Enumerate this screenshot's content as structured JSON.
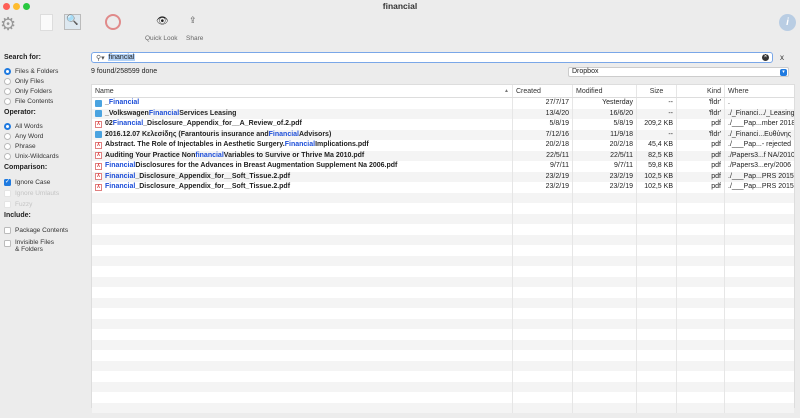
{
  "window": {
    "title": "financial"
  },
  "toolbar": {
    "quick_look": "Quick Look",
    "share": "Share"
  },
  "sidebar": {
    "search_for": {
      "label": "Search for:",
      "options": [
        "Files & Folders",
        "Only Files",
        "Only Folders",
        "File Contents"
      ],
      "selected": 0
    },
    "operator": {
      "label": "Operator:",
      "options": [
        "All Words",
        "Any Word",
        "Phrase",
        "Unix-Wildcards"
      ],
      "selected": 0
    },
    "comparison": {
      "label": "Comparison:",
      "ignore_case": "Ignore Case",
      "ignore_umlauts": "Ignore Umlauts",
      "fuzzy": "Fuzzy"
    },
    "include": {
      "label": "Include:",
      "package_contents": "Package Contents",
      "invisible_1": "Invisible Files",
      "invisible_2": "& Folders"
    }
  },
  "search": {
    "value": "financial",
    "status": "9 found/258599 done",
    "location": "Dropbox",
    "close": "x"
  },
  "table": {
    "headers": {
      "name": "Name",
      "created": "Created",
      "modified": "Modified",
      "size": "Size",
      "kind": "Kind",
      "where": "Where"
    },
    "rows": [
      {
        "type": "folder",
        "pre": "_",
        "hl": "Financial",
        "post": "",
        "created": "27/7/17",
        "modified": "Yesterday",
        "size": "--",
        "kind": "'fldr'",
        "where": "."
      },
      {
        "type": "folder",
        "pre": "_Volkswagen ",
        "hl": "Financial",
        "post": " Services Leasing",
        "created": "13/4/20",
        "modified": "16/6/20",
        "size": "--",
        "kind": "'fldr'",
        "where": "./_Financi.../_Leasing"
      },
      {
        "type": "pdf",
        "pre": "02 ",
        "hl": "Financial",
        "post": "_Disclosure_Appendix_for__A_Review_of.2.pdf",
        "created": "5/8/19",
        "modified": "5/8/19",
        "size": "209,2 KB",
        "kind": "pdf",
        "where": "./___Pap...mber 2018"
      },
      {
        "type": "folder",
        "pre": "2016.12.07 Κελεσίδης (Farantouris insurance and ",
        "hl": "Financial",
        "post": " Advisors)",
        "created": "7/12/16",
        "modified": "11/9/18",
        "size": "--",
        "kind": "'fldr'",
        "where": "./_Financi...Ευθύνης"
      },
      {
        "type": "pdf",
        "pre": "Abstract. The Role of Injectables in Aesthetic Surgery. ",
        "hl": "Financial",
        "post": " Implications.pdf",
        "created": "20/2/18",
        "modified": "20/2/18",
        "size": "45,4 KB",
        "kind": "pdf",
        "where": "./___Pap...- rejected"
      },
      {
        "type": "pdf",
        "pre": "Auditing Your Practice Non",
        "hl": "financial",
        "post": " Variables to Survive or Thrive Ma 2010.pdf",
        "created": "22/5/11",
        "modified": "22/5/11",
        "size": "82,5 KB",
        "kind": "pdf",
        "where": "./Papers3...f NA/2010"
      },
      {
        "type": "pdf",
        "pre": "",
        "hl": "Financial",
        "post": " Disclosures for the Advances in Breast Augmentation Supplement Na 2006.pdf",
        "created": "9/7/11",
        "modified": "9/7/11",
        "size": "59,8 KB",
        "kind": "pdf",
        "where": "./Papers3...ery/2006"
      },
      {
        "type": "pdf",
        "pre": "",
        "hl": "Financial",
        "post": "_Disclosure_Appendix_for__Soft_Tissue.2.pdf",
        "created": "23/2/19",
        "modified": "23/2/19",
        "size": "102,5 KB",
        "kind": "pdf",
        "where": "./___Pap...PRS 2015"
      },
      {
        "type": "pdf",
        "pre": "",
        "hl": "Financial",
        "post": "_Disclosure_Appendix_for__Soft_Tissue.2.pdf",
        "created": "23/2/19",
        "modified": "23/2/19",
        "size": "102,5 KB",
        "kind": "pdf",
        "where": "./___Pap...PRS 2015"
      }
    ]
  }
}
